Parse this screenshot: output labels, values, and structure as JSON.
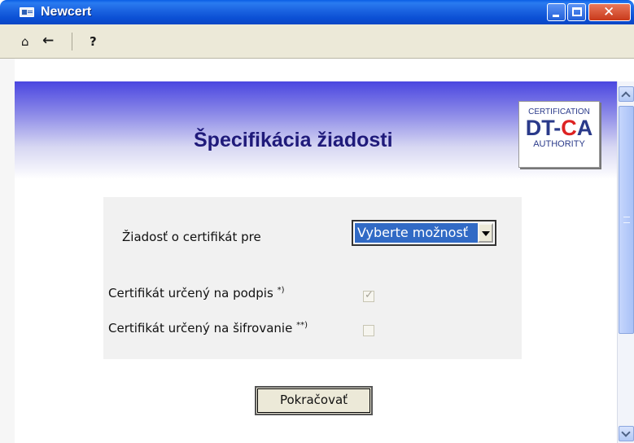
{
  "window": {
    "title": "Newcert"
  },
  "toolbar": {
    "home_icon": "home-icon",
    "back_icon": "back-arrow-icon",
    "help_label": "?"
  },
  "page": {
    "heading": "Špecifikácia žiadosti",
    "logo": {
      "top": "CERTIFICATION",
      "mid_left": "DT",
      "mid_dash": "-",
      "mid_c": "C",
      "mid_a": "A",
      "bottom": "AUTHORITY"
    }
  },
  "form": {
    "certificate_for_label": "Žiadosť o certifikát pre",
    "certificate_for_selected": "Vyberte možnosť",
    "sign_label": "Certifikát určený na podpis",
    "sign_note": "*)",
    "sign_checked": true,
    "encrypt_label": "Certifikát určený na šifrovanie",
    "encrypt_note": "**)",
    "encrypt_checked": false,
    "continue_label": "Pokračovať"
  },
  "colors": {
    "titlebar": "#0a4fd4",
    "heading": "#1f1a7a",
    "select_highlight": "#316ac5",
    "close_button": "#c8391a"
  }
}
